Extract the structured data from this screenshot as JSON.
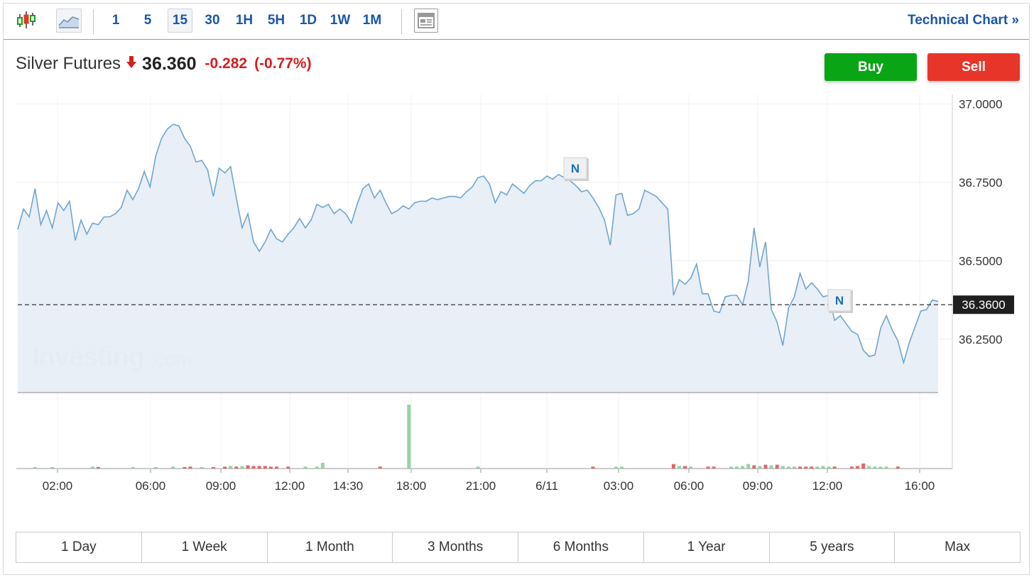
{
  "toolbar": {
    "intervals": [
      "1",
      "5",
      "15",
      "30",
      "1H",
      "5H",
      "1D",
      "1W",
      "1M"
    ],
    "selected_interval": "15",
    "technical_chart_label": "Technical Chart »"
  },
  "quote": {
    "instrument": "Silver Futures",
    "price": "36.360",
    "change": "-0.282",
    "change_pct": "(-0.77%)"
  },
  "actions": {
    "buy_label": "Buy",
    "sell_label": "Sell"
  },
  "watermark": {
    "brand": "Investing",
    "suffix": ".com"
  },
  "news_markers": [
    {
      "label": "N",
      "time": "6/11 02:15"
    },
    {
      "label": "N",
      "time": "6/11 12:15"
    }
  ],
  "ranges": [
    "1 Day",
    "1 Week",
    "1 Month",
    "3 Months",
    "6 Months",
    "1 Year",
    "5 years",
    "Max"
  ],
  "colors": {
    "up": "#0aa515",
    "down": "#e8352a",
    "line": "#6fa6cf",
    "area": "#e8eef6",
    "link": "#1a56a8"
  },
  "chart_data": {
    "type": "area",
    "x_tick_labels": [
      "02:00",
      "06:00",
      "09:00",
      "12:00",
      "14:30",
      "18:00",
      "21:00",
      "6/11",
      "03:00",
      "06:00",
      "09:00",
      "12:00",
      "16:00"
    ],
    "y_tick_labels": [
      "37.0000",
      "36.7500",
      "36.5000",
      "36.2500"
    ],
    "ylim": [
      36.08,
      37.02
    ],
    "last_price_label": "36.3600",
    "last_price": 36.36,
    "price_series": [
      36.6,
      36.665,
      36.64,
      36.73,
      36.615,
      36.66,
      36.605,
      36.685,
      36.66,
      36.69,
      36.565,
      36.63,
      36.585,
      36.62,
      36.615,
      36.64,
      36.64,
      36.65,
      36.67,
      36.725,
      36.695,
      36.73,
      36.785,
      36.735,
      36.835,
      36.89,
      36.92,
      36.935,
      36.93,
      36.89,
      36.865,
      36.815,
      36.82,
      36.79,
      36.705,
      36.795,
      36.78,
      36.8,
      36.7,
      36.605,
      36.65,
      36.56,
      36.53,
      36.56,
      36.6,
      36.57,
      36.56,
      36.585,
      36.605,
      36.635,
      36.605,
      36.63,
      36.68,
      36.67,
      36.68,
      36.65,
      36.665,
      36.65,
      36.62,
      36.68,
      36.73,
      36.745,
      36.7,
      36.725,
      36.685,
      36.65,
      36.66,
      36.675,
      36.665,
      36.685,
      36.69,
      36.69,
      36.7,
      36.695,
      36.7,
      36.705,
      36.705,
      36.7,
      36.72,
      36.735,
      36.765,
      36.77,
      36.745,
      36.685,
      36.72,
      36.71,
      36.745,
      36.73,
      36.715,
      36.74,
      36.755,
      36.755,
      36.77,
      36.76,
      36.775,
      36.765,
      36.755,
      36.74,
      36.72,
      36.725,
      36.7,
      36.67,
      36.63,
      36.55,
      36.71,
      36.715,
      36.645,
      36.65,
      36.665,
      36.725,
      36.715,
      36.705,
      36.685,
      36.665,
      36.39,
      36.44,
      36.425,
      36.445,
      36.49,
      36.395,
      36.395,
      36.34,
      36.335,
      36.385,
      36.39,
      36.39,
      36.36,
      36.435,
      36.605,
      36.48,
      36.56,
      36.345,
      36.305,
      36.23,
      36.35,
      36.385,
      36.46,
      36.41,
      36.43,
      36.41,
      36.385,
      36.39,
      36.31,
      36.325,
      36.3,
      36.275,
      36.265,
      36.215,
      36.195,
      36.2,
      36.285,
      36.325,
      36.28,
      36.245,
      36.175,
      36.24,
      36.29,
      36.34,
      36.345,
      36.375,
      36.37
    ],
    "volume_series": [
      {
        "i": 3,
        "v": 2,
        "s": "up"
      },
      {
        "i": 6,
        "v": 2,
        "s": "up"
      },
      {
        "i": 13,
        "v": 3,
        "s": "up"
      },
      {
        "i": 14,
        "v": 2,
        "s": "down"
      },
      {
        "i": 20,
        "v": 2,
        "s": "up"
      },
      {
        "i": 24,
        "v": 2,
        "s": "up"
      },
      {
        "i": 27,
        "v": 3,
        "s": "up"
      },
      {
        "i": 29,
        "v": 2,
        "s": "down"
      },
      {
        "i": 30,
        "v": 3,
        "s": "down"
      },
      {
        "i": 32,
        "v": 2,
        "s": "up"
      },
      {
        "i": 34,
        "v": 2,
        "s": "down"
      },
      {
        "i": 36,
        "v": 3,
        "s": "down"
      },
      {
        "i": 37,
        "v": 4,
        "s": "up"
      },
      {
        "i": 38,
        "v": 3,
        "s": "down"
      },
      {
        "i": 39,
        "v": 4,
        "s": "up"
      },
      {
        "i": 40,
        "v": 5,
        "s": "down"
      },
      {
        "i": 41,
        "v": 4,
        "s": "down"
      },
      {
        "i": 42,
        "v": 4,
        "s": "down"
      },
      {
        "i": 43,
        "v": 4,
        "s": "down"
      },
      {
        "i": 44,
        "v": 3,
        "s": "down"
      },
      {
        "i": 45,
        "v": 3,
        "s": "down"
      },
      {
        "i": 47,
        "v": 3,
        "s": "down"
      },
      {
        "i": 50,
        "v": 3,
        "s": "up"
      },
      {
        "i": 52,
        "v": 3,
        "s": "up"
      },
      {
        "i": 53,
        "v": 9,
        "s": "up"
      },
      {
        "i": 63,
        "v": 3,
        "s": "down"
      },
      {
        "i": 68,
        "v": 100,
        "s": "up"
      },
      {
        "i": 80,
        "v": 3,
        "s": "up"
      },
      {
        "i": 100,
        "v": 3,
        "s": "down"
      },
      {
        "i": 104,
        "v": 3,
        "s": "up"
      },
      {
        "i": 105,
        "v": 3,
        "s": "up"
      },
      {
        "i": 114,
        "v": 7,
        "s": "down"
      },
      {
        "i": 115,
        "v": 4,
        "s": "up"
      },
      {
        "i": 116,
        "v": 4,
        "s": "down"
      },
      {
        "i": 117,
        "v": 3,
        "s": "up"
      },
      {
        "i": 120,
        "v": 3,
        "s": "down"
      },
      {
        "i": 121,
        "v": 3,
        "s": "down"
      },
      {
        "i": 124,
        "v": 3,
        "s": "up"
      },
      {
        "i": 125,
        "v": 3,
        "s": "up"
      },
      {
        "i": 126,
        "v": 4,
        "s": "up"
      },
      {
        "i": 127,
        "v": 7,
        "s": "up"
      },
      {
        "i": 128,
        "v": 5,
        "s": "down"
      },
      {
        "i": 129,
        "v": 4,
        "s": "up"
      },
      {
        "i": 130,
        "v": 6,
        "s": "down"
      },
      {
        "i": 131,
        "v": 5,
        "s": "up"
      },
      {
        "i": 132,
        "v": 6,
        "s": "down"
      },
      {
        "i": 133,
        "v": 4,
        "s": "up"
      },
      {
        "i": 134,
        "v": 3,
        "s": "up"
      },
      {
        "i": 135,
        "v": 3,
        "s": "up"
      },
      {
        "i": 136,
        "v": 3,
        "s": "down"
      },
      {
        "i": 137,
        "v": 3,
        "s": "down"
      },
      {
        "i": 138,
        "v": 3,
        "s": "down"
      },
      {
        "i": 139,
        "v": 3,
        "s": "up"
      },
      {
        "i": 140,
        "v": 4,
        "s": "up"
      },
      {
        "i": 141,
        "v": 3,
        "s": "up"
      },
      {
        "i": 142,
        "v": 3,
        "s": "down"
      },
      {
        "i": 145,
        "v": 3,
        "s": "down"
      },
      {
        "i": 146,
        "v": 4,
        "s": "down"
      },
      {
        "i": 147,
        "v": 8,
        "s": "down"
      },
      {
        "i": 148,
        "v": 4,
        "s": "up"
      },
      {
        "i": 149,
        "v": 3,
        "s": "up"
      },
      {
        "i": 150,
        "v": 3,
        "s": "up"
      },
      {
        "i": 151,
        "v": 3,
        "s": "up"
      },
      {
        "i": 153,
        "v": 3,
        "s": "down"
      }
    ]
  }
}
